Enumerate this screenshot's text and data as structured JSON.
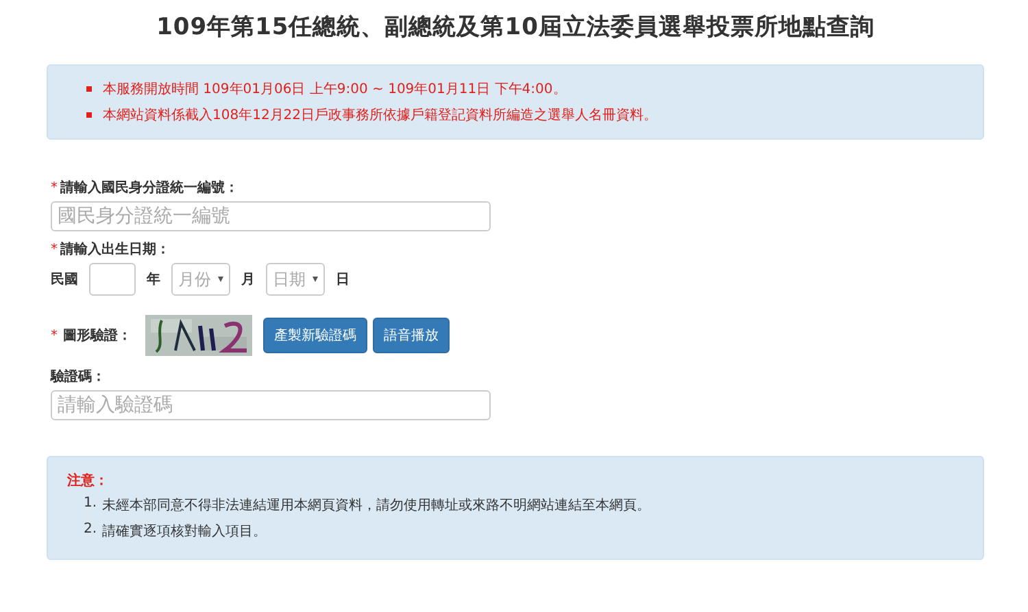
{
  "title": "109年第15任總統、副總統及第10屆立法委員選舉投票所地點查詢",
  "info": [
    "本服務開放時間 109年01月06日 上午9:00 ~ 109年01月11日 下午4:00。",
    "本網站資料係截入108年12月22日戶政事務所依據戶籍登記資料所編造之選舉人名冊資料。"
  ],
  "id_field": {
    "required_mark": "*",
    "label": "請輸入國民身分證統一編號：",
    "placeholder": "國民身分證統一編號"
  },
  "birth": {
    "required_mark": "*",
    "label": "請輸入出生日期：",
    "era": "民國",
    "year_unit": "年",
    "month": "月份",
    "month_unit": "月",
    "day": "日期",
    "day_unit": "日"
  },
  "captcha": {
    "required_mark": "*",
    "label": "圖形驗證：",
    "buttons": [
      "產製新驗證碼",
      "語音播放"
    ]
  },
  "code_field": {
    "label": "驗證碼：",
    "placeholder": "請輸入驗證碼"
  },
  "notice": {
    "title": "注意：",
    "items": [
      {
        "number": "1.",
        "text": "未經本部同意不得非法連結運用本網頁資料，請勿使用轉址或來路不明網站連結至本網頁。"
      },
      {
        "number": "2.",
        "text": "請確實逐項核對輸入項目。"
      }
    ]
  }
}
